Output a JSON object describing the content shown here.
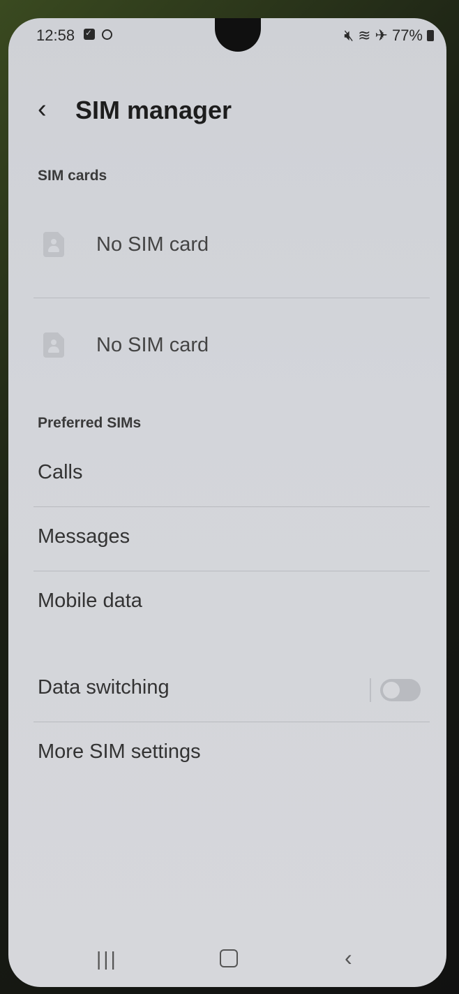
{
  "status_bar": {
    "time": "12:58",
    "battery": "77%",
    "icons_left": [
      "checkbox-notification-icon",
      "circle-notification-icon"
    ],
    "icons_right": [
      "mute-icon",
      "wifi-icon",
      "airplane-icon",
      "battery-icon"
    ]
  },
  "header": {
    "back_icon": "chevron-left-icon",
    "title": "SIM manager"
  },
  "sim_cards": {
    "section_label": "SIM cards",
    "items": [
      {
        "icon": "sim-card-icon",
        "label": "No SIM card"
      },
      {
        "icon": "sim-card-icon",
        "label": "No SIM card"
      }
    ]
  },
  "preferred_sims": {
    "section_label": "Preferred SIMs",
    "items": [
      {
        "label": "Calls"
      },
      {
        "label": "Messages"
      },
      {
        "label": "Mobile data"
      }
    ]
  },
  "data_switching": {
    "label": "Data switching",
    "enabled": false
  },
  "more_settings": {
    "label": "More SIM settings"
  },
  "nav_bar": {
    "icons": [
      "recent-apps-icon",
      "home-icon",
      "back-icon"
    ]
  }
}
